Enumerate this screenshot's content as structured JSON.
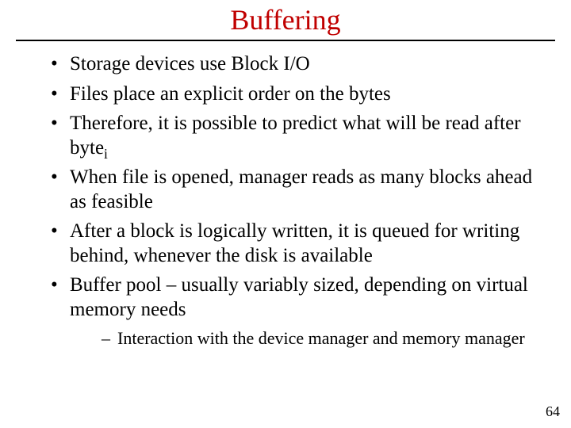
{
  "colors": {
    "title": "#c00000"
  },
  "title": "Buffering",
  "bullets": [
    {
      "text": "Storage devices use Block I/O"
    },
    {
      "text": "Files place an explicit order on the bytes"
    },
    {
      "prefix": "Therefore, it is possible to predict what will be read after byte",
      "sub": "i"
    },
    {
      "text": "When file is opened, manager reads as many blocks ahead as feasible"
    },
    {
      "text": "After a block is logically written, it is queued for writing behind, whenever the disk is available"
    },
    {
      "text": "Buffer pool – usually variably sized, depending on virtual memory needs",
      "children": [
        {
          "text": "Interaction with the device manager and memory manager"
        }
      ]
    }
  ],
  "pageNumber": "64"
}
